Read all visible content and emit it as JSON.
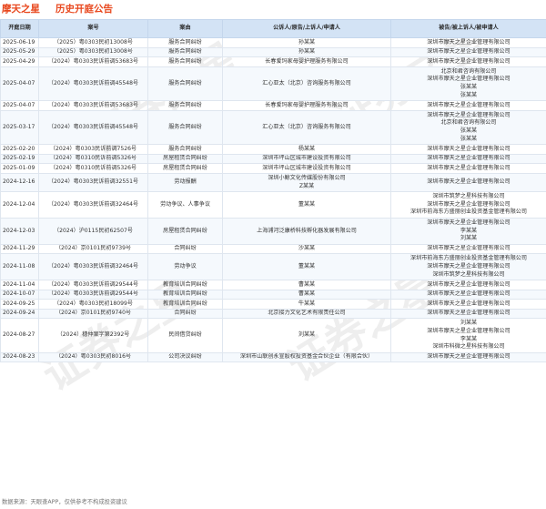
{
  "header": {
    "brand": "摩天之星",
    "subtitle": "历史开庭公告"
  },
  "table": {
    "columns": [
      "开庭日期",
      "案号",
      "案由",
      "公诉人/原告/上诉人/申请人",
      "被告/被上诉人/被申请人"
    ],
    "rows": [
      {
        "date": "2025-06-19",
        "case_no": "（2025）粤0303民初13008号",
        "cause": "服务合同纠纷",
        "plaintiffs": [
          "孙某某"
        ],
        "defendants": [
          "深圳市摩天之星企业管理有限公司"
        ]
      },
      {
        "date": "2025-05-29",
        "case_no": "（2025）粤0303民初13008号",
        "cause": "服务合同纠纷",
        "plaintiffs": [
          "孙某某"
        ],
        "defendants": [
          "深圳市摩天之星企业管理有限公司"
        ]
      },
      {
        "date": "2025-04-29",
        "case_no": "（2024）粤0303民诉前调53683号",
        "cause": "服务合同纠纷",
        "plaintiffs": [
          "长春爱玛家母婴护理服务有限公司"
        ],
        "defendants": [
          "深圳市摩天之星企业管理有限公司"
        ]
      },
      {
        "date": "2025-04-07",
        "case_no": "（2024）粤0303民诉前调45548号",
        "cause": "服务合同纠纷",
        "plaintiffs": [
          "汇心亚太（北京）咨询服务有限公司"
        ],
        "defendants": [
          "北京和君咨询有限公司",
          "深圳市摩天之星企业管理有限公司",
          "张某某",
          "张某某"
        ]
      },
      {
        "date": "2025-04-07",
        "case_no": "（2024）粤0303民诉前调53683号",
        "cause": "服务合同纠纷",
        "plaintiffs": [
          "长春爱玛家母婴护理服务有限公司"
        ],
        "defendants": [
          "深圳市摩天之星企业管理有限公司"
        ]
      },
      {
        "date": "2025-03-17",
        "case_no": "（2024）粤0303民诉前调45548号",
        "cause": "服务合同纠纷",
        "plaintiffs": [
          "汇心亚太（北京）咨询服务有限公司"
        ],
        "defendants": [
          "深圳市摩天之星企业管理有限公司",
          "北京和君咨询有限公司",
          "张某某",
          "张某某"
        ]
      },
      {
        "date": "2025-02-20",
        "case_no": "（2024）粤0303民诉前调7526号",
        "cause": "服务合同纠纷",
        "plaintiffs": [
          "杨某某"
        ],
        "defendants": [
          "深圳市摩天之星企业管理有限公司"
        ]
      },
      {
        "date": "2025-02-19",
        "case_no": "（2024）粤0310民诉前调5326号",
        "cause": "房屋租赁合同纠纷",
        "plaintiffs": [
          "深圳市坪山区城市建设投资有限公司"
        ],
        "defendants": [
          "深圳市摩天之星企业管理有限公司"
        ]
      },
      {
        "date": "2025-01-09",
        "case_no": "（2024）粤0310民诉前调5326号",
        "cause": "房屋租赁合同纠纷",
        "plaintiffs": [
          "深圳市坪山区城市建设投资有限公司"
        ],
        "defendants": [
          "深圳市摩天之星企业管理有限公司"
        ]
      },
      {
        "date": "2024-12-16",
        "case_no": "（2024）粤0303民诉前调32551号",
        "cause": "劳动报酬",
        "plaintiffs": [
          "深圳小鲸文化传媒股份有限公司",
          "Z某某"
        ],
        "defendants": [
          "深圳市摩天之星企业管理有限公司"
        ]
      },
      {
        "date": "2024-12-04",
        "case_no": "（2024）粤0303民诉前调32464号",
        "cause": "劳动争议、人事争议",
        "plaintiffs": [
          "董某某"
        ],
        "defendants": [
          "深圳市筑梦之星科技有限公司",
          "深圳市摩天之星企业管理有限公司",
          "深圳市前海东方盛丽创业投资基金管理有限公司"
        ]
      },
      {
        "date": "2024-12-03",
        "case_no": "（2024）沪0115民初62507号",
        "cause": "房屋租赁合同纠纷",
        "plaintiffs": [
          "上海浦河泛康桥科技孵化器发展有限公司"
        ],
        "defendants": [
          "深圳市摩天之星企业管理有限公司",
          "李某某",
          "刘某某"
        ]
      },
      {
        "date": "2024-11-29",
        "case_no": "（2024）京0101民初9739号",
        "cause": "合同纠纷",
        "plaintiffs": [
          "沙某某"
        ],
        "defendants": [
          "深圳市摩天之星企业管理有限公司"
        ]
      },
      {
        "date": "2024-11-08",
        "case_no": "（2024）粤0303民诉前调32464号",
        "cause": "劳动争议",
        "plaintiffs": [
          "董某某"
        ],
        "defendants": [
          "深圳市前海东方盛丽创业投资基金管理有限公司",
          "深圳市摩天之星企业管理有限公司",
          "深圳市筑梦之星科技有限公司"
        ]
      },
      {
        "date": "2024-11-04",
        "case_no": "（2024）粤0303民诉前调29544号",
        "cause": "教育培训合同纠纷",
        "plaintiffs": [
          "曹某某"
        ],
        "defendants": [
          "深圳市摩天之星企业管理有限公司"
        ]
      },
      {
        "date": "2024-10-07",
        "case_no": "（2024）粤0303民诉前调29544号",
        "cause": "教育培训合同纠纷",
        "plaintiffs": [
          "曹某某"
        ],
        "defendants": [
          "深圳市摩天之星企业管理有限公司"
        ]
      },
      {
        "date": "2024-09-25",
        "case_no": "（2024）粤0303民初18099号",
        "cause": "教育培训合同纠纷",
        "plaintiffs": [
          "牛某某"
        ],
        "defendants": [
          "深圳市摩天之星企业管理有限公司"
        ]
      },
      {
        "date": "2024-09-24",
        "case_no": "（2024）京0101民初9740号",
        "cause": "合同纠纷",
        "plaintiffs": [
          "北京接力文化艺术有限责任公司"
        ],
        "defendants": [
          "深圳市摩天之星企业管理有限公司"
        ]
      },
      {
        "date": "2024-08-27",
        "case_no": "（2024）穗仲案字第2392号",
        "cause": "民间借贷纠纷",
        "plaintiffs": [
          "刘某某"
        ],
        "defendants": [
          "刘某某",
          "深圳市摩天之星企业管理有限公司",
          "李某某",
          "深圳市科微之星科技有限公司"
        ]
      },
      {
        "date": "2024-08-23",
        "case_no": "（2024）粤0303民初8016号",
        "cause": "公司决议纠纷",
        "plaintiffs": [
          "深圳市山联创永宣股权投资基金合伙企业（有限合伙）"
        ],
        "defendants": [
          "深圳市摩天之星企业管理有限公司"
        ]
      }
    ]
  },
  "footer": {
    "source": "数据来源：天眼查APP，仅供参考不构成投资建议"
  },
  "watermark": {
    "text": "证券之星"
  },
  "colors": {
    "brand": "#e8471d",
    "header_bg": "#d3e3f5",
    "alt_row": "#f5f9fd"
  }
}
